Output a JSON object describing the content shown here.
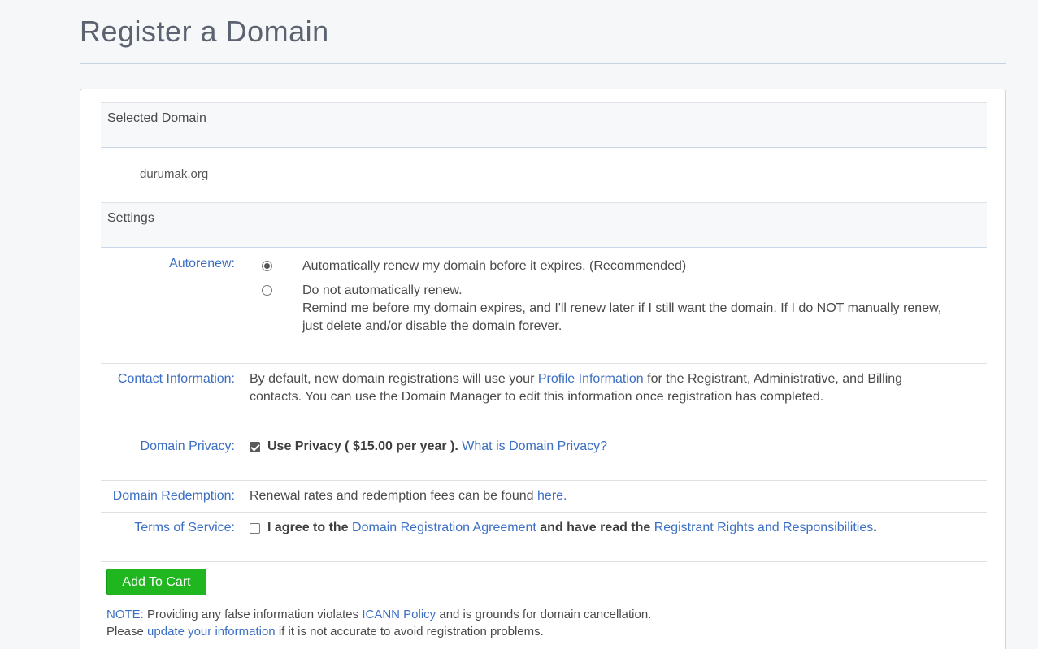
{
  "page": {
    "title": "Register a Domain"
  },
  "selected_domain": {
    "heading": "Selected Domain",
    "domain": "durumak.org"
  },
  "settings": {
    "heading": "Settings",
    "autorenew": {
      "label": "Autorenew:",
      "options": [
        {
          "text": "Automatically renew my domain before it expires. (Recommended)",
          "checked": true
        },
        {
          "text": "Do not automatically renew.",
          "checked": false,
          "detail": "Remind me before my domain expires, and I'll renew later if I still want the domain. If I do NOT manually renew, just delete and/or disable the domain forever."
        }
      ]
    },
    "contact": {
      "label": "Contact Information:",
      "text_before": "By default, new domain registrations will use your ",
      "link": "Profile Information",
      "text_after": " for the Registrant, Administrative, and Billing contacts. You can use the Domain Manager to edit this information once registration has completed."
    },
    "privacy": {
      "label": "Domain Privacy:",
      "checked": true,
      "bold_text": "Use Privacy ( $15.00 per year ).",
      "link": "What is Domain Privacy?"
    },
    "redemption": {
      "label": "Domain Redemption:",
      "text": "Renewal rates and redemption fees can be found ",
      "link": "here."
    },
    "terms": {
      "label": "Terms of Service:",
      "checked": false,
      "bold_1": "I agree to the ",
      "link_1": "Domain Registration Agreement",
      "bold_2": " and have read the ",
      "link_2": "Registrant Rights and Responsibilities",
      "bold_3": "."
    }
  },
  "actions": {
    "add_to_cart": "Add To Cart"
  },
  "note": {
    "label": "NOTE:",
    "line1_text": " Providing any false information violates ",
    "line1_link": "ICANN Policy",
    "line1_after": " and is grounds for domain cancellation.",
    "line2_before": "Please ",
    "line2_link": "update your information",
    "line2_after": " if it is not accurate to avoid registration problems."
  },
  "colors": {
    "accent": "#3b6fc4",
    "button": "#1fb61f",
    "title": "#5b6370"
  }
}
